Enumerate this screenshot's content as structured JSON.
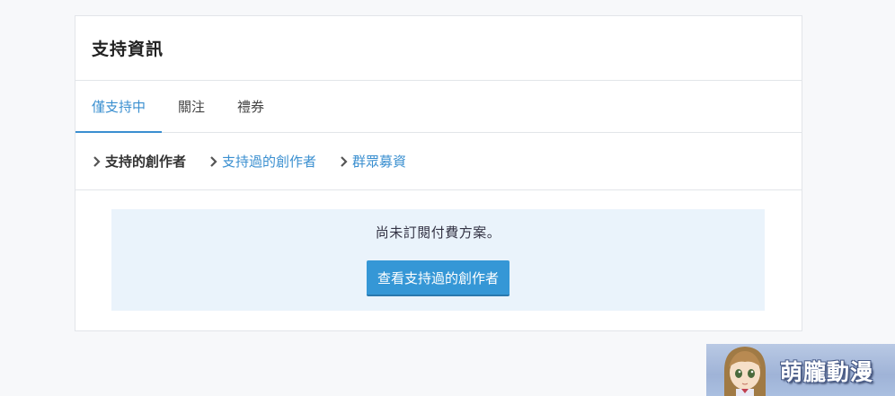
{
  "card": {
    "title": "支持資訊"
  },
  "tabs": [
    {
      "label": "僅支持中",
      "active": true
    },
    {
      "label": "關注",
      "active": false
    },
    {
      "label": "禮券",
      "active": false
    }
  ],
  "subnav": [
    {
      "label": "支持的創作者",
      "current": true
    },
    {
      "label": "支持過的創作者",
      "current": false
    },
    {
      "label": "群眾募資",
      "current": false
    }
  ],
  "notice": {
    "message": "尚未訂閱付費方案。",
    "button_label": "查看支持過的創作者"
  },
  "watermark": {
    "text": "萌朧動漫"
  },
  "colors": {
    "accent": "#3a8fd0",
    "button": "#3597d6",
    "notice_bg": "#eaf3fb",
    "page_bg": "#f7f8fa"
  }
}
